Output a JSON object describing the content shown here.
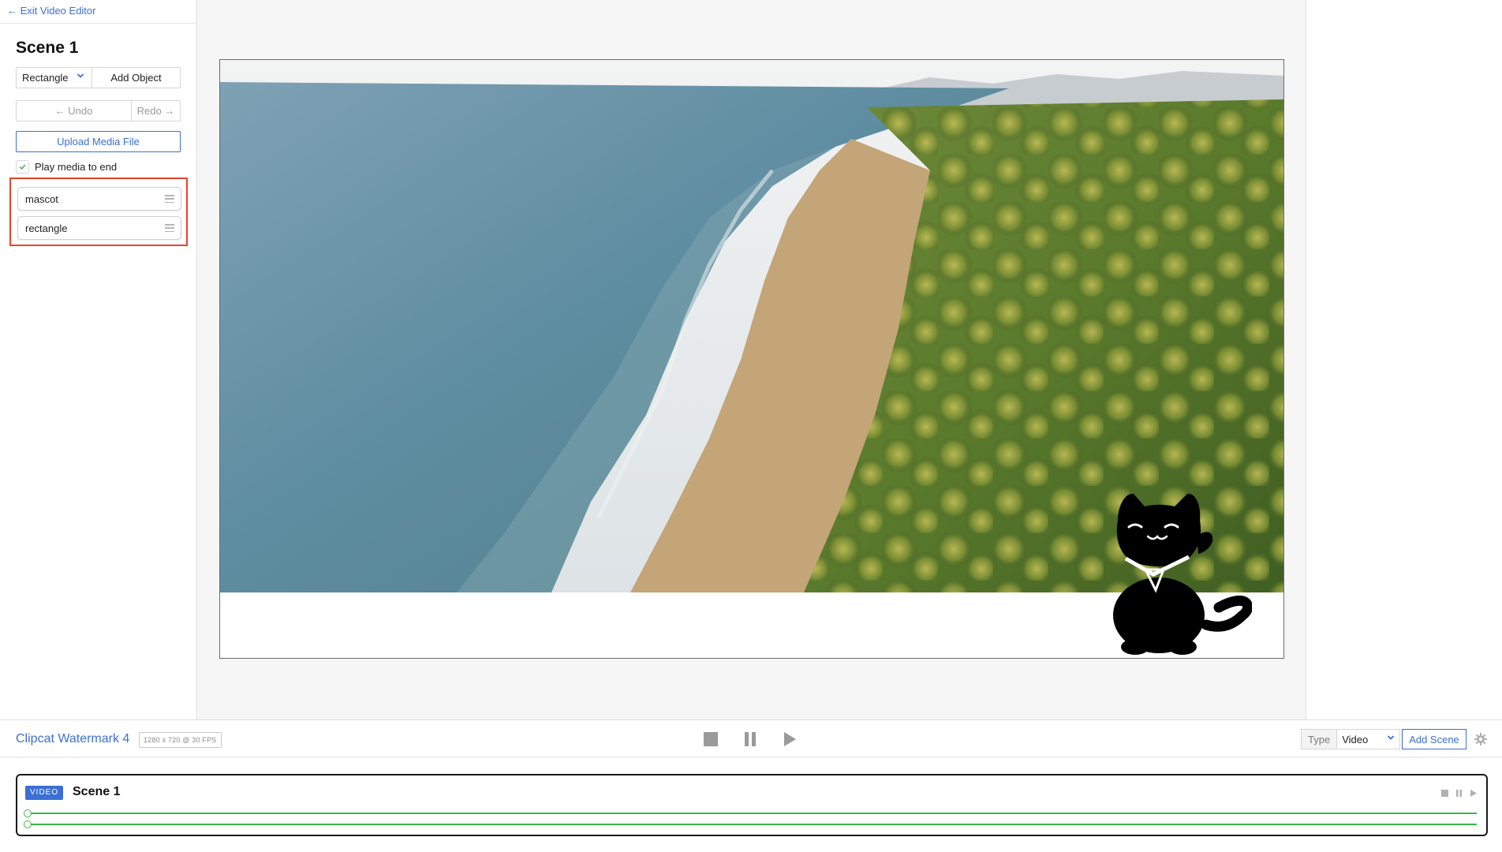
{
  "sidebar": {
    "exit_label": "← Exit Video Editor",
    "scene_title": "Scene 1",
    "object_type": "Rectangle",
    "add_object_label": "Add Object",
    "undo_label": "← Undo",
    "redo_label": "Redo →",
    "upload_label": "Upload Media File",
    "play_to_end_label": "Play media to end",
    "play_to_end_checked": true,
    "objects": [
      {
        "label": "mascot"
      },
      {
        "label": "rectangle"
      }
    ]
  },
  "bottom_bar": {
    "project_name": "Clipcat Watermark 4",
    "project_meta": "1280 x 720 @ 30 FPS",
    "type_label": "Type",
    "type_value": "Video",
    "add_scene_label": "Add Scene"
  },
  "timeline": {
    "badge": "VIDEO",
    "scene_title": "Scene 1"
  },
  "colors": {
    "accent": "#3b6fd6",
    "highlight": "#e8442b",
    "track": "#3cb54a"
  },
  "icons": [
    "chevron-down-icon",
    "check-icon",
    "drag-handle-icon",
    "stop-icon",
    "pause-icon",
    "play-icon",
    "gear-icon"
  ]
}
